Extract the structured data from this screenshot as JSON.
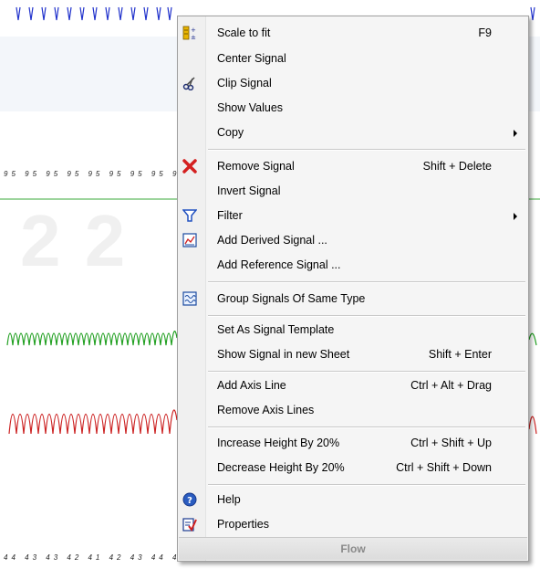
{
  "background": {
    "top_ticks": "95 95 95 95 95 95 95 95 95 95",
    "bottom_ticks": "44 43 43 42 41 42 43 44 45 44",
    "watermark": "2 2",
    "colors": {
      "blue_signal": "#2233cc",
      "green_signal": "#22a022",
      "red_signal": "#cc2222",
      "baseline": "#3aa83a"
    }
  },
  "menu": {
    "items": [
      {
        "label": "Scale to fit",
        "shortcut": "F9",
        "icon": "scale-icon"
      },
      {
        "label": "Center Signal",
        "shortcut": "",
        "icon": ""
      },
      {
        "label": "Clip Signal",
        "shortcut": "",
        "icon": "scissors-icon"
      },
      {
        "label": "Show Values",
        "shortcut": "",
        "icon": ""
      },
      {
        "label": "Copy",
        "shortcut": "",
        "icon": "",
        "submenu": true
      },
      {
        "label": "Remove Signal",
        "shortcut": "Shift + Delete",
        "icon": "red-x-icon"
      },
      {
        "label": "Invert Signal",
        "shortcut": "",
        "icon": ""
      },
      {
        "label": "Filter",
        "shortcut": "",
        "icon": "funnel-icon",
        "submenu": true
      },
      {
        "label": "Add Derived Signal ...",
        "shortcut": "",
        "icon": "derived-chart-icon"
      },
      {
        "label": "Add Reference Signal ...",
        "shortcut": "",
        "icon": ""
      },
      {
        "label": "Group Signals Of Same Type",
        "shortcut": "",
        "icon": "group-signals-icon"
      },
      {
        "label": "Set As Signal Template",
        "shortcut": "",
        "icon": ""
      },
      {
        "label": "Show Signal in new Sheet",
        "shortcut": "Shift + Enter",
        "icon": ""
      },
      {
        "label": "Add Axis Line",
        "shortcut": "Ctrl + Alt + Drag",
        "icon": ""
      },
      {
        "label": "Remove Axis Lines",
        "shortcut": "",
        "icon": ""
      },
      {
        "label": "Increase Height By 20%",
        "shortcut": "Ctrl + Shift + Up",
        "icon": ""
      },
      {
        "label": "Decrease Height By 20%",
        "shortcut": "Ctrl + Shift + Down",
        "icon": ""
      },
      {
        "label": "Help",
        "shortcut": "",
        "icon": "help-icon"
      },
      {
        "label": "Properties",
        "shortcut": "",
        "icon": "properties-icon"
      }
    ],
    "footer": "Flow"
  }
}
